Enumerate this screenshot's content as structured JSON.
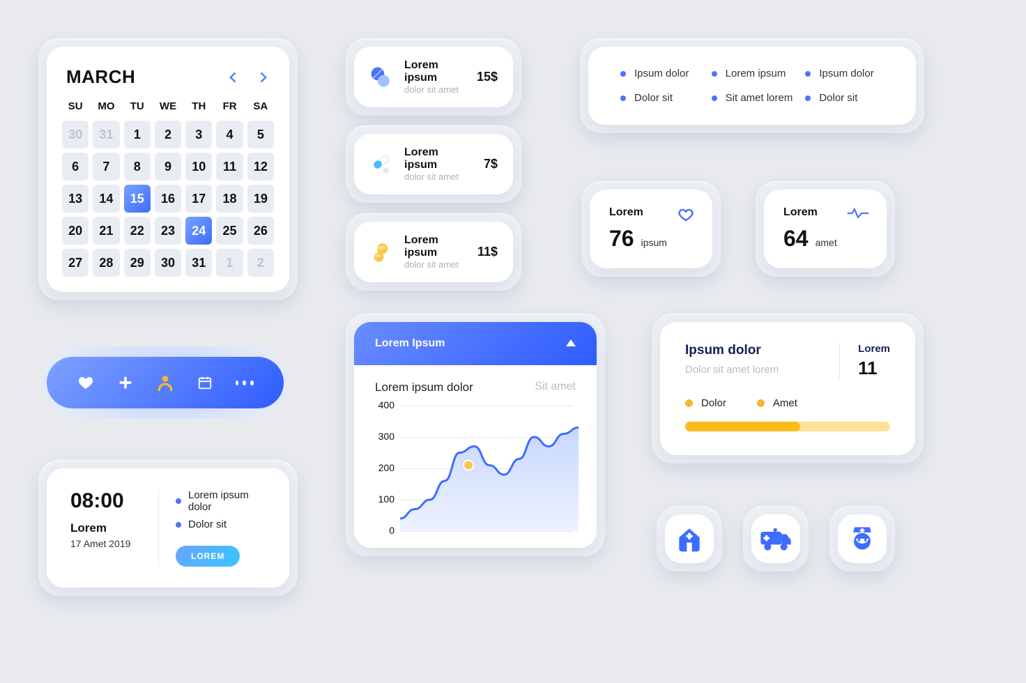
{
  "calendar": {
    "month": "MARCH",
    "dow": [
      "SU",
      "MO",
      "TU",
      "WE",
      "TH",
      "FR",
      "SA"
    ],
    "weeks": [
      [
        {
          "d": "30",
          "f": true
        },
        {
          "d": "31",
          "f": true
        },
        {
          "d": "1"
        },
        {
          "d": "2"
        },
        {
          "d": "3"
        },
        {
          "d": "4"
        },
        {
          "d": "5"
        }
      ],
      [
        {
          "d": "6"
        },
        {
          "d": "7"
        },
        {
          "d": "8"
        },
        {
          "d": "9"
        },
        {
          "d": "10"
        },
        {
          "d": "11"
        },
        {
          "d": "12"
        }
      ],
      [
        {
          "d": "13"
        },
        {
          "d": "14"
        },
        {
          "d": "15",
          "sel": true
        },
        {
          "d": "16"
        },
        {
          "d": "17"
        },
        {
          "d": "18"
        },
        {
          "d": "19"
        }
      ],
      [
        {
          "d": "20"
        },
        {
          "d": "21"
        },
        {
          "d": "22"
        },
        {
          "d": "23"
        },
        {
          "d": "24",
          "sel": true
        },
        {
          "d": "25"
        },
        {
          "d": "26"
        }
      ],
      [
        {
          "d": "27"
        },
        {
          "d": "28"
        },
        {
          "d": "29"
        },
        {
          "d": "30"
        },
        {
          "d": "31"
        },
        {
          "d": "1",
          "f": true
        },
        {
          "d": "2",
          "f": true
        }
      ]
    ]
  },
  "time_card": {
    "time": "08:00",
    "label": "Lorem",
    "date": "17 Amet 2019",
    "bullets": [
      "Lorem ipsum dolor",
      "Dolor sit"
    ],
    "button": "LOREM"
  },
  "meds": [
    {
      "title": "Lorem ipsum",
      "sub": "dolor sit amet",
      "price": "15$",
      "icon": "pills-blue"
    },
    {
      "title": "Lorem ipsum",
      "sub": "dolor sit amet",
      "price": "7$",
      "icon": "capsule"
    },
    {
      "title": "Lorem ipsum",
      "sub": "dolor sit amet",
      "price": "11$",
      "icon": "coins-yellow"
    }
  ],
  "legend": [
    "Ipsum dolor",
    "Lorem ipsum",
    "Ipsum dolor",
    "Dolor sit",
    "Sit amet lorem",
    "Dolor sit"
  ],
  "stats": [
    {
      "label": "Lorem",
      "value": "76",
      "unit": "ipsum",
      "icon": "heart"
    },
    {
      "label": "Lorem",
      "value": "64",
      "unit": "amet",
      "icon": "pulse"
    }
  ],
  "chart_card": {
    "header": "Lorem Ipsum",
    "subtitle": "Lorem ipsum dolor",
    "right_label": "Sit amet"
  },
  "chart_data": {
    "type": "line",
    "title": "Lorem ipsum dolor",
    "xlabel": "",
    "ylabel": "",
    "ylim": [
      0,
      400
    ],
    "yticks": [
      0,
      100,
      200,
      300,
      400
    ],
    "x": [
      0,
      1,
      2,
      3,
      4,
      5,
      6,
      7,
      8,
      9,
      10
    ],
    "values": [
      40,
      70,
      100,
      160,
      250,
      270,
      210,
      180,
      230,
      300,
      270,
      310,
      330
    ],
    "highlight_point": {
      "x": 4.6,
      "y": 210
    }
  },
  "progress": {
    "title": "Ipsum dolor",
    "subtitle": "Dolor sit amet lorem",
    "right_label": "Lorem",
    "right_value": "11",
    "legend": [
      "Dolor",
      "Amet"
    ],
    "percent": 56
  },
  "icons_row": [
    "hospital",
    "ambulance",
    "nurse"
  ]
}
